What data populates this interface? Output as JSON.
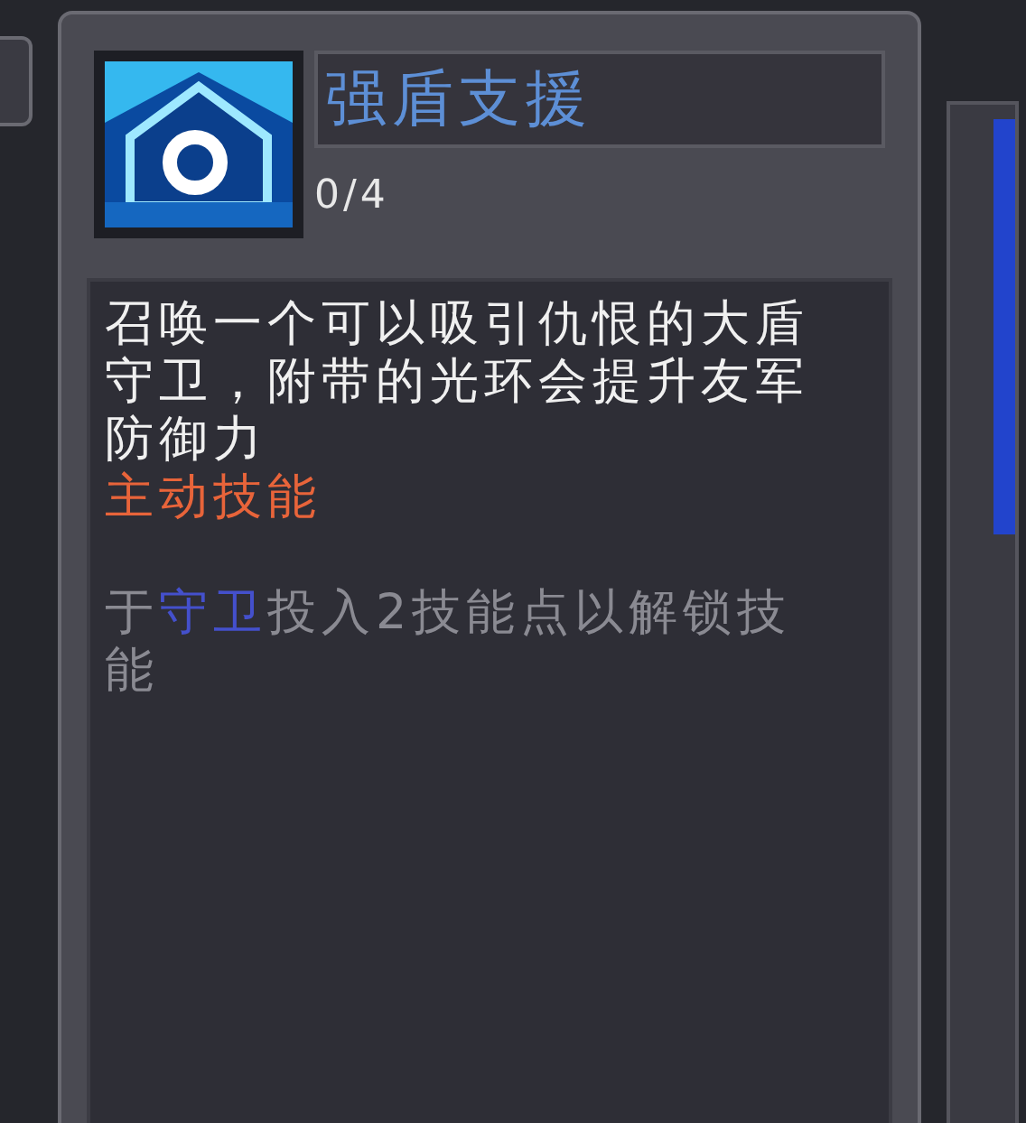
{
  "skill": {
    "name": "强盾支援",
    "points": "0/4"
  },
  "description": "召唤一个可以吸引仇恨的大盾守卫，附带的光环会提升友军防御力",
  "skill_type": "主动技能",
  "requirement": [
    {
      "kind": "plain",
      "text": "于"
    },
    {
      "kind": "link",
      "text": "守卫"
    },
    {
      "kind": "plain",
      "text": "投入2技能点以解锁技能"
    }
  ]
}
